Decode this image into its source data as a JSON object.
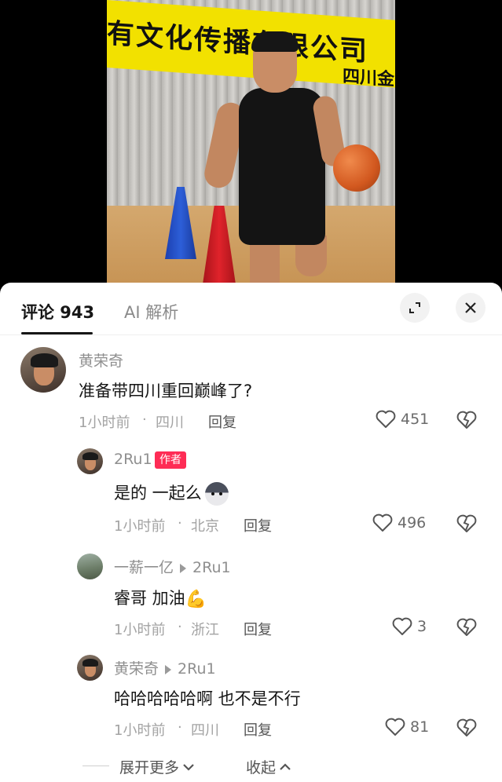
{
  "video": {
    "banner_text": "有文化传播有限公司",
    "banner_text2": "四川金"
  },
  "tabs": [
    {
      "label": "评论 943"
    },
    {
      "label": "AI 解析"
    }
  ],
  "comments": [
    {
      "user": "黄荣奇",
      "text": "准备带四川重回巅峰了?",
      "time": "1小时前",
      "location": "四川",
      "reply": "回复",
      "likes": "451"
    },
    {
      "user": "2Ru1",
      "badge": "作者",
      "text": "是的 一起么",
      "emoji": "husky-emoji",
      "time": "1小时前",
      "location": "北京",
      "reply": "回复",
      "likes": "496"
    },
    {
      "user": "一薪一亿",
      "reply_to": "2Ru1",
      "text": "睿哥 加油",
      "emoji": "flexed-biceps-emoji",
      "time": "1小时前",
      "location": "浙江",
      "reply": "回复",
      "likes": "3"
    },
    {
      "user": "黄荣奇",
      "reply_to": "2Ru1",
      "text": "哈哈哈哈哈啊 也不是不行",
      "time": "1小时前",
      "location": "四川",
      "reply": "回复",
      "likes": "81"
    }
  ],
  "footer": {
    "expand": "展开更多",
    "collapse": "收起"
  },
  "colors": {
    "accent": "#fe2c55",
    "text": "#161616",
    "muted": "#8f8f8f"
  }
}
